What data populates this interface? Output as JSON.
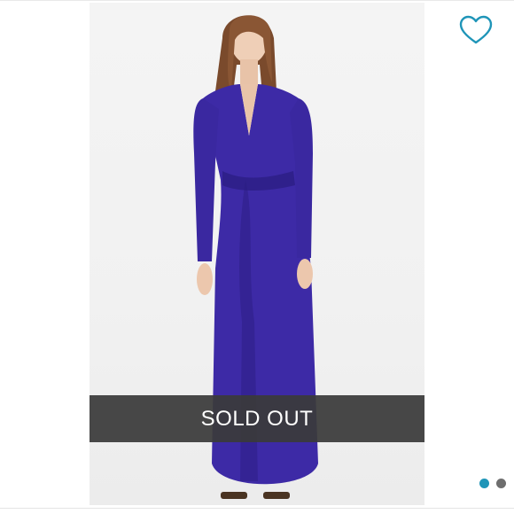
{
  "listing": {
    "status_label": "SOLD OUT",
    "photo_count": 2,
    "active_photo_index": 0
  },
  "icons": {
    "like": "heart-outline-icon"
  },
  "colors": {
    "accent": "#1f95b8",
    "dot_inactive": "#6e6e6e",
    "banner": "#3a3a3a",
    "dress": "#3d2aa6"
  }
}
